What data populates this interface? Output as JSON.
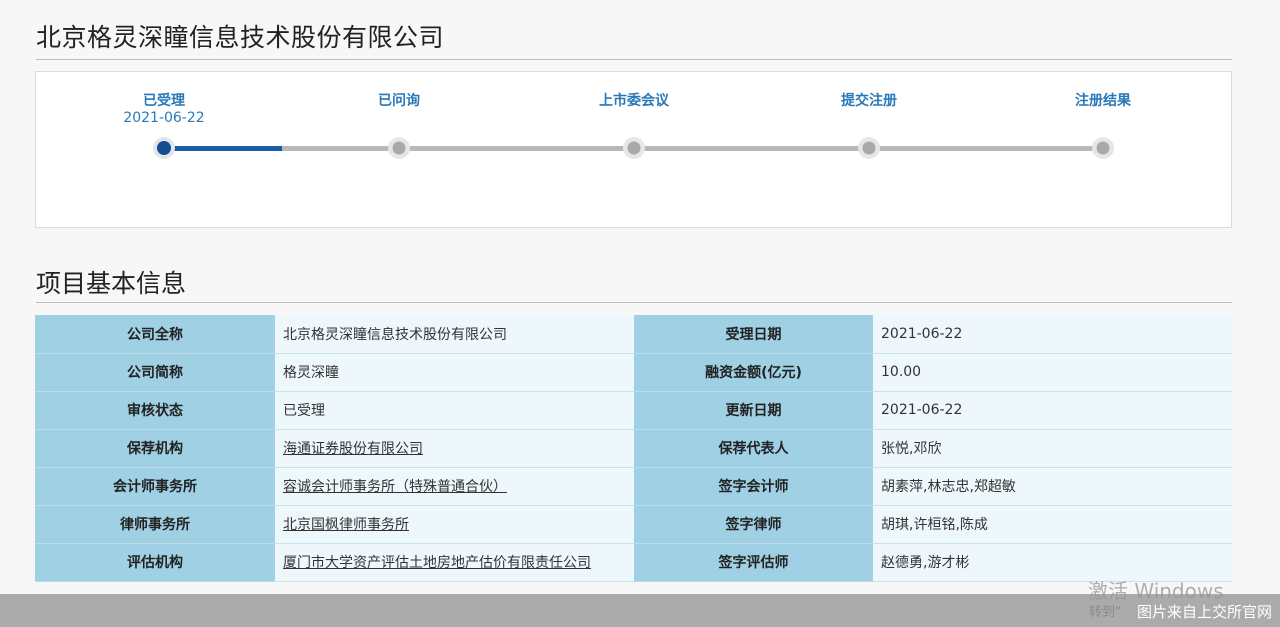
{
  "header": {
    "company_title": "北京格灵深瞳信息技术股份有限公司"
  },
  "progress": {
    "steps": [
      {
        "label": "已受理",
        "date": "2021-06-22",
        "active": true
      },
      {
        "label": "已问询",
        "date": "",
        "active": false
      },
      {
        "label": "上市委会议",
        "date": "",
        "active": false
      },
      {
        "label": "提交注册",
        "date": "",
        "active": false
      },
      {
        "label": "注册结果",
        "date": "",
        "active": false
      }
    ],
    "completed_fraction": 0.125
  },
  "section": {
    "title": "项目基本信息"
  },
  "info_table": {
    "rows": [
      {
        "k1": "公司全称",
        "v1": "北京格灵深瞳信息技术股份有限公司",
        "k2": "受理日期",
        "v2": "2021-06-22"
      },
      {
        "k1": "公司简称",
        "v1": "格灵深瞳",
        "k2": "融资金额(亿元)",
        "v2": "10.00"
      },
      {
        "k1": "审核状态",
        "v1": "已受理",
        "k2": "更新日期",
        "v2": "2021-06-22"
      },
      {
        "k1": "保荐机构",
        "v1": "海通证券股份有限公司",
        "k2": "保荐代表人",
        "v2": "张悦,邓欣"
      },
      {
        "k1": "会计师事务所",
        "v1": "容诚会计师事务所（特殊普通合伙）",
        "k2": "签字会计师",
        "v2": "胡素萍,林志忠,郑超敏"
      },
      {
        "k1": "律师事务所",
        "v1": "北京国枫律师事务所",
        "k2": "签字律师",
        "v2": "胡琪,许桓铭,陈成"
      },
      {
        "k1": "评估机构",
        "v1": "厦门市大学资产评估土地房地产估价有限责任公司",
        "k2": "签字评估师",
        "v2": "赵德勇,游才彬"
      }
    ]
  },
  "overlay": {
    "watermark_main": "激活 Windows",
    "watermark_sub": "转到“",
    "caption": "图片来自上交所官网"
  }
}
